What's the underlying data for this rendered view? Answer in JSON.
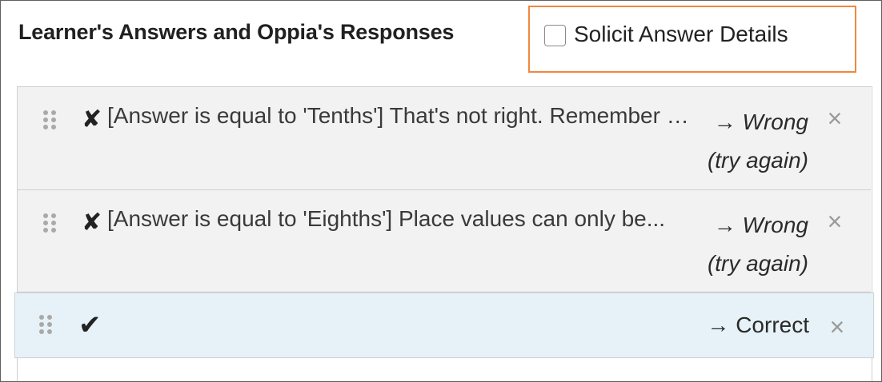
{
  "section": {
    "title": "Learner's Answers and Oppia's Responses"
  },
  "solicit": {
    "label": "Solicit Answer Details",
    "checked": false,
    "highlight_color": "#f0883e"
  },
  "rules": [
    {
      "status": "wrong",
      "status_icon": "cross-mark-icon",
      "summary": "[Answer is equal to 'Tenths'] That's not right. Remember the place value names...",
      "arrow": "→",
      "destination_line1": "Wrong",
      "destination_line2": "(try again)"
    },
    {
      "status": "wrong",
      "status_icon": "cross-mark-icon",
      "summary": "[Answer is equal to 'Eighths'] Place values can only be...",
      "arrow": "→",
      "destination_line1": "Wrong",
      "destination_line2": "(try again)"
    },
    {
      "status": "correct",
      "status_icon": "check-mark-icon",
      "summary": "",
      "arrow": "→",
      "destination_line1": "Correct",
      "destination_line2": ""
    }
  ],
  "icons": {
    "drag": "drag-handle-icon",
    "delete": "close-icon",
    "wrong": "✘",
    "correct": "✔",
    "close": "×"
  },
  "colors": {
    "row_bg": "#f2f2f2",
    "active_row_bg": "#e6f2f7",
    "text": "#212121"
  }
}
